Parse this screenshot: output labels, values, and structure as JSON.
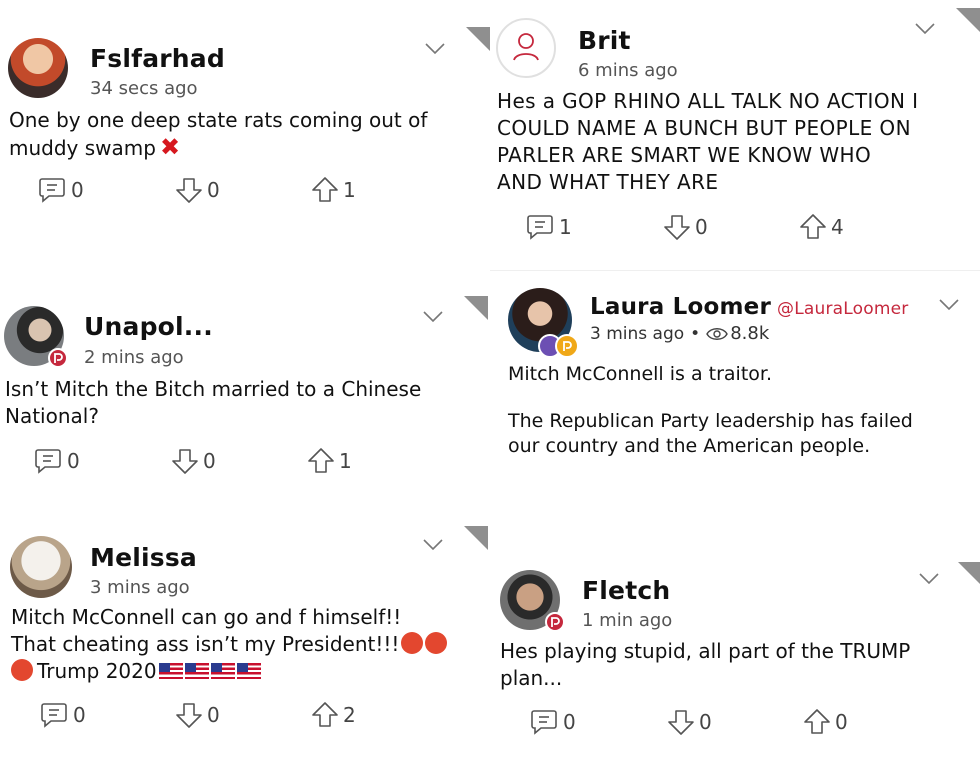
{
  "posts": [
    {
      "name": "Fslfarhad",
      "time": "34 secs ago",
      "text": [
        "One by one deep state rats coming out of",
        "muddy swamp"
      ],
      "comments": "0",
      "downvotes": "0",
      "upvotes": "1"
    },
    {
      "name": "Brit",
      "time": "6 mins ago",
      "text": [
        "Hes a GOP RHINO ALL TALK NO ACTION I",
        "COULD NAME A BUNCH BUT PEOPLE ON",
        "PARLER ARE SMART WE KNOW WHO",
        "AND WHAT THEY ARE"
      ],
      "comments": "1",
      "downvotes": "0",
      "upvotes": "4"
    },
    {
      "name": "Unapol...",
      "time": "2 mins ago",
      "text": [
        "Isn’t Mitch the Bitch married to a Chinese",
        "National?"
      ],
      "comments": "0",
      "downvotes": "0",
      "upvotes": "1"
    },
    {
      "name": "Laura Loomer",
      "handle": "@LauraLoomer",
      "time": "3 mins ago",
      "views": "8.8k",
      "text": [
        "Mitch McConnell is a traitor."
      ],
      "text2": [
        "The Republican Party leadership has failed",
        "our country and the American people."
      ]
    },
    {
      "name": "Melissa",
      "time": "3 mins ago",
      "text": [
        "Mitch McConnell can go and f himself!!",
        "That cheating ass isn’t my President!!!",
        "Trump 2020"
      ],
      "comments": "0",
      "downvotes": "0",
      "upvotes": "2"
    },
    {
      "name": "Fletch",
      "time": "1 min ago",
      "text": [
        "Hes playing stupid, all part of the TRUMP",
        "plan..."
      ],
      "comments": "0",
      "downvotes": "0",
      "upvotes": "0"
    }
  ],
  "icons": {
    "comment": "comment-icon",
    "downvote": "downvote-icon",
    "upvote": "upvote-icon",
    "chevron": "chevron-down-icon",
    "views": "eye-icon",
    "badge": "parler-badge-icon"
  },
  "colors": {
    "accent": "#c5283d",
    "text": "#111111",
    "muted": "#555555"
  }
}
